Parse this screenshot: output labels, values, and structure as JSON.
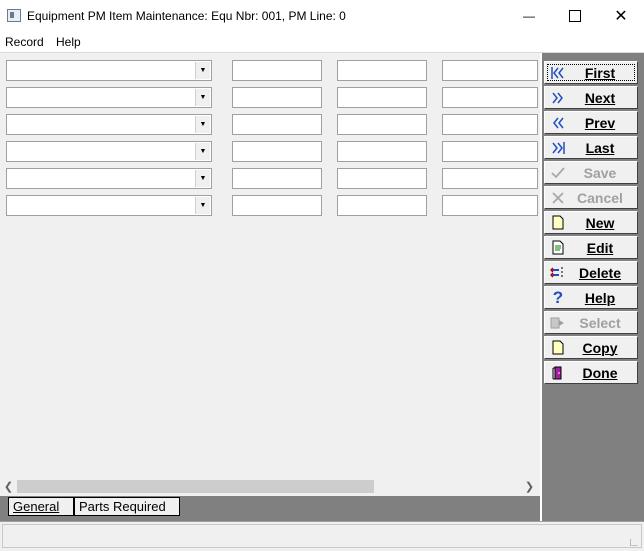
{
  "window": {
    "title": "Equipment PM Item Maintenance: Equ Nbr: 001, PM Line: 0",
    "minimize_glyph": "—",
    "maximize_glyph": "☐",
    "close_glyph": "✕"
  },
  "menu": [
    "Record",
    "Help"
  ],
  "form": {
    "row_count": 6
  },
  "tabs": [
    {
      "label": "General",
      "active": true
    },
    {
      "label": "Parts Required",
      "active": false
    }
  ],
  "side_buttons": [
    {
      "label": "First",
      "icon": "first-icon",
      "enabled": true
    },
    {
      "label": "Next",
      "icon": "next-icon",
      "enabled": true
    },
    {
      "label": "Prev",
      "icon": "prev-icon",
      "enabled": true
    },
    {
      "label": "Last",
      "icon": "last-icon",
      "enabled": true
    },
    {
      "label": "Save",
      "icon": "check-icon",
      "enabled": false
    },
    {
      "label": "Cancel",
      "icon": "x-icon",
      "enabled": false
    },
    {
      "label": "New",
      "icon": "new-document-icon",
      "enabled": true
    },
    {
      "label": "Edit",
      "icon": "edit-document-icon",
      "enabled": true
    },
    {
      "label": "Delete",
      "icon": "delete-icon",
      "enabled": true
    },
    {
      "label": "Help",
      "icon": "question-icon",
      "enabled": true
    },
    {
      "label": "Select",
      "icon": "select-icon",
      "enabled": false
    },
    {
      "label": "Copy",
      "icon": "copy-document-icon",
      "enabled": true
    },
    {
      "label": "Done",
      "icon": "door-exit-icon",
      "enabled": true
    }
  ],
  "colors": {
    "panel": "#808080",
    "window_bg": "#f0f0f0",
    "nav_icon_blue": "#1f4fbf",
    "disabled_text": "#a0a0a0"
  }
}
